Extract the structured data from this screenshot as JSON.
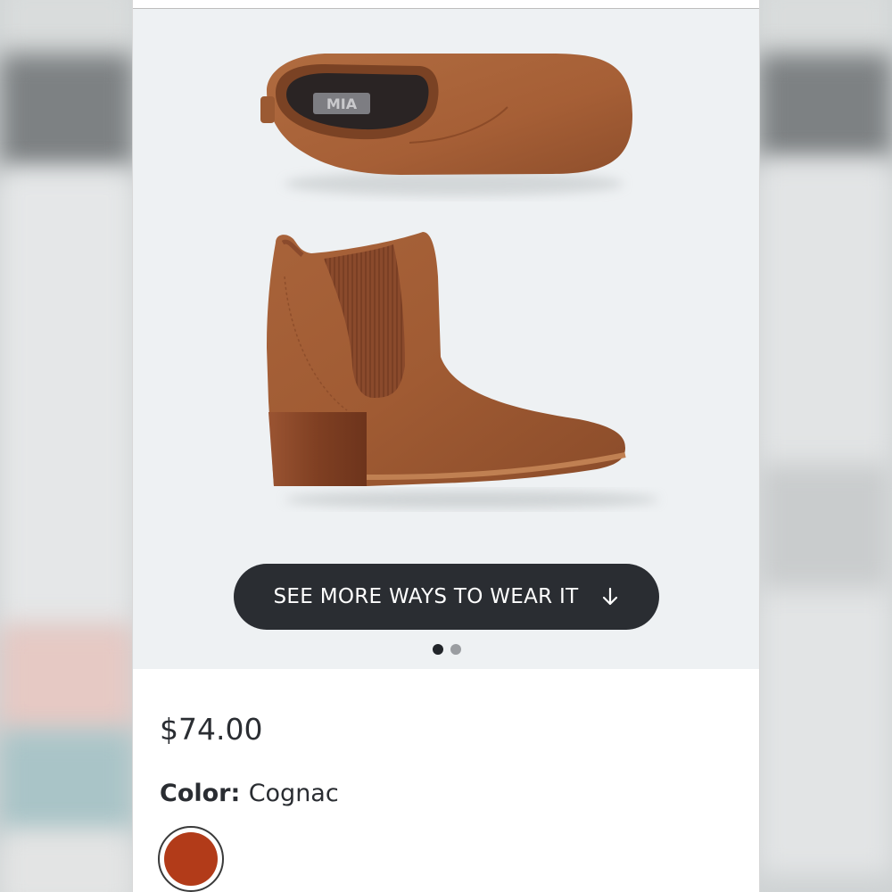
{
  "product": {
    "image_alt": "Cognac chelsea ankle boots",
    "boot_brand_text": "MIA",
    "wear_button_label": "SEE MORE WAYS TO WEAR IT",
    "wear_button_icon": "arrow-down-icon",
    "carousel": {
      "total": 2,
      "active": 1
    },
    "price": "$74.00",
    "color_label": "Color:",
    "color_value": "Cognac",
    "swatch_color": "#b23b19"
  },
  "colors": {
    "gallery_bg": "#eef1f3",
    "button_bg": "#2a2d32",
    "boot_leather": "#a8643a",
    "heel_wood": "#8a4a2a"
  }
}
